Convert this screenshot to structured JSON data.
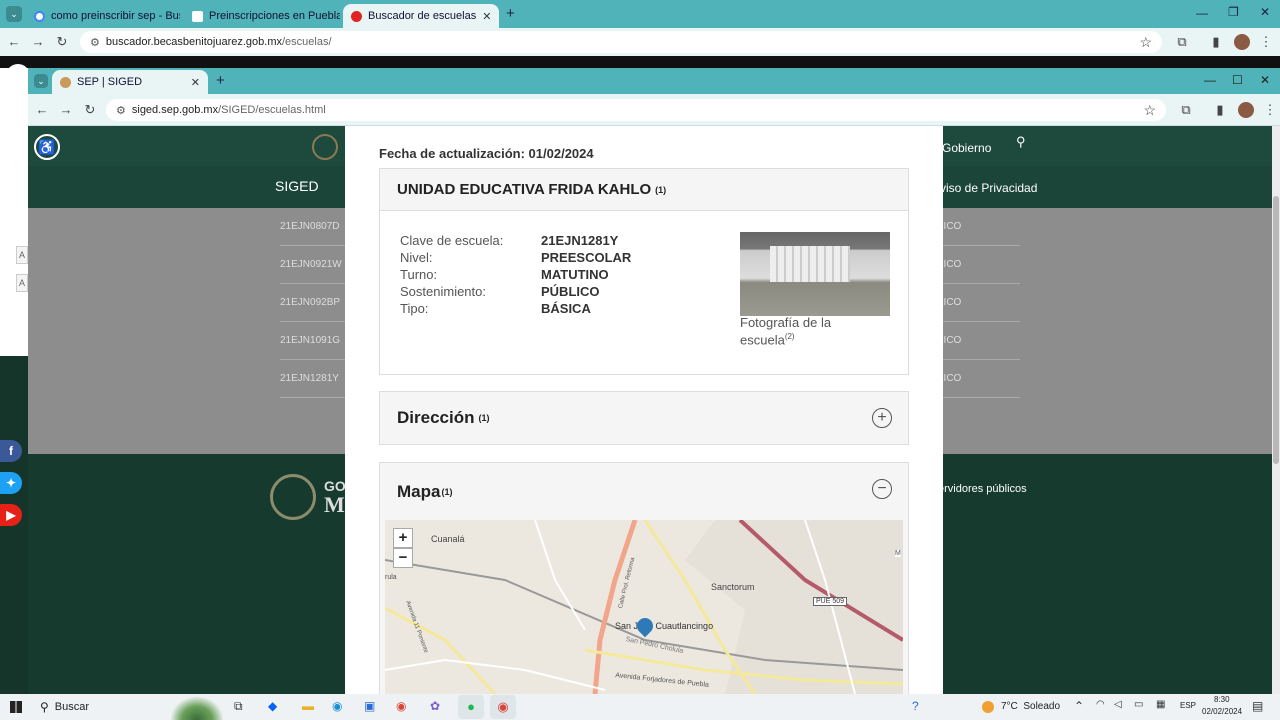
{
  "outer_browser": {
    "tabs": [
      {
        "title": "como preinscribir sep - Buscar",
        "favicon_color": "#ffffff"
      },
      {
        "title": "Preinscripciones en Puebla: Te d",
        "favicon_color": "#ffffff"
      },
      {
        "title": "Buscador de escuelas",
        "favicon_color": "#e02424"
      }
    ],
    "new_tab": "+",
    "url_domain": "buscador.becasbenitojuarez.gob.mx",
    "url_path": "/escuelas/"
  },
  "inner_browser": {
    "tab_title": "SEP | SIGED",
    "new_tab": "+",
    "url_domain": "siged.sep.gob.mx",
    "url_path": "/SIGED/escuelas.html"
  },
  "site": {
    "siged_label": "SIGED",
    "gobierno_label": "Gobierno",
    "aviso_label": "viso de Privacidad",
    "footer_right": "ervidores públicos",
    "footer_left": "GO",
    "footer_left2": "M",
    "list_left": [
      "21EJN0807D",
      "21EJN0921W",
      "21EJN092BP",
      "21EJN1091G",
      "21EJN1281Y"
    ],
    "list_right": [
      "LICO",
      "LICO",
      "LICO",
      "LICO",
      "LICO"
    ],
    "side_a": "A"
  },
  "modal": {
    "fecha": "Fecha de actualización: 01/02/2024",
    "school_name": "UNIDAD EDUCATIVA FRIDA KAHLO",
    "footnote1": "(1)",
    "fields": [
      {
        "label": "Clave de escuela:",
        "value": "21EJN1281Y"
      },
      {
        "label": "Nivel:",
        "value": "PREESCOLAR"
      },
      {
        "label": "Turno:",
        "value": "MATUTINO"
      },
      {
        "label": "Sostenimiento:",
        "value": "PÚBLICO"
      },
      {
        "label": "Tipo:",
        "value": "BÁSICA"
      }
    ],
    "photo_caption": "Fotografía de la escuela",
    "photo_footnote": "(2)",
    "direccion_title": "Dirección",
    "mapa_title": "Mapa",
    "plus": "+",
    "minus": "−"
  },
  "map": {
    "zoom_in": "+",
    "zoom_out": "−",
    "labels": [
      "Cuanalá",
      "Sanctorum",
      "San Juan Cuautlancingo",
      "PUE 509",
      "Avenida Forjadores de Puebla",
      "San Pedro Cholula",
      "Calle Prol. Reforma",
      "Avenida 11 Poniente",
      "rula",
      "M"
    ]
  },
  "taskbar": {
    "search": "Buscar",
    "weather": "7°C  Soleado",
    "lang": "ESP",
    "time": "8:30",
    "date": "02/02/2024"
  }
}
